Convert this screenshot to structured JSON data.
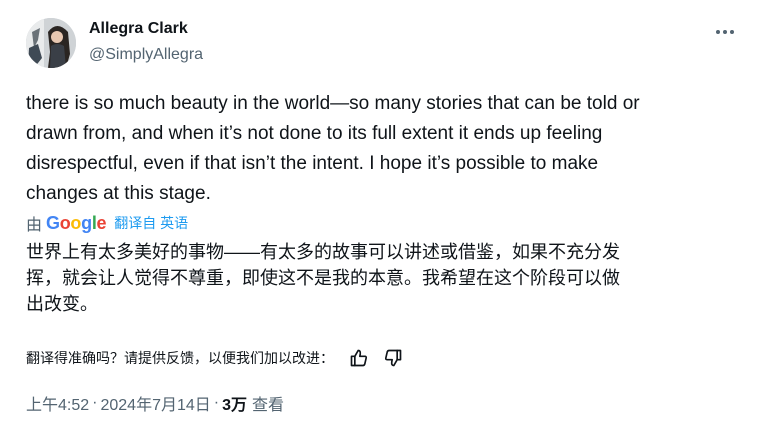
{
  "author": {
    "name": "Allegra Clark",
    "handle": "@SimplyAllegra"
  },
  "tweet_text": "there is so much beauty in the world—so many stories that can be told or\ndrawn from, and when it’s not done to its full extent it ends up feeling\ndisrespectful, even if that isn’t the intent. I hope it’s possible to make\nchanges at this stage.",
  "translation": {
    "prefix": "由",
    "google_letters": [
      "G",
      "o",
      "o",
      "g",
      "l",
      "e"
    ],
    "google_colors": [
      "#4285F4",
      "#EA4335",
      "#FBBC05",
      "#4285F4",
      "#34A853",
      "#EA4335"
    ],
    "info": "翻译自 英语",
    "text": "世界上有太多美好的事物——有太多的故事可以讲述或借鉴，如果不充分发\n挥，就会让人觉得不尊重，即使这不是我的本意。我希望在这个阶段可以做\n出改变。"
  },
  "feedback": {
    "prompt": "翻译得准确吗？请提供反馈，以便我们加以改进：",
    "thumbs_up_icon": "thumbs-up-icon",
    "thumbs_down_icon": "thumbs-down-icon"
  },
  "meta": {
    "time": "上午4:52",
    "separator": "·",
    "date": "2024年7月14日",
    "views_count": "3万",
    "views_label": "查看"
  },
  "colors": {
    "text": "#0f1419",
    "secondary": "#536471",
    "link": "#1d9bf0"
  }
}
